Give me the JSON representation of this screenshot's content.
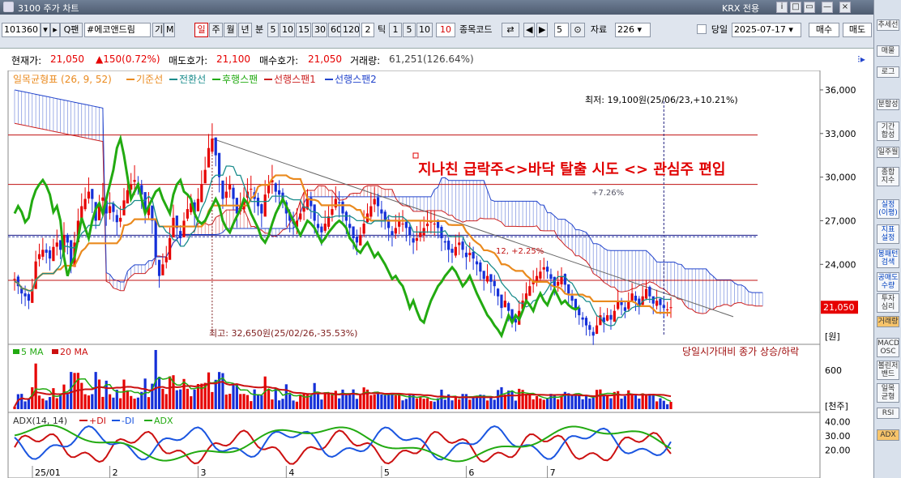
{
  "window": {
    "title": "3100 주가 차트",
    "market": "KRX 전용",
    "buttons": [
      "i",
      "□",
      "▭",
      "—",
      "×"
    ]
  },
  "toolbar": {
    "code": "101360",
    "name": "#에코앤드림",
    "name_btns": [
      "기",
      "M"
    ],
    "period_tabs": [
      "일",
      "주",
      "월",
      "년",
      "분"
    ],
    "active_period": "일",
    "minute_options": [
      "5",
      "10",
      "15",
      "30",
      "60",
      "120"
    ],
    "tick_label": "틱",
    "tick_value": "2",
    "tick_options": [
      "1",
      "5",
      "10"
    ],
    "tick_selected": "10",
    "compare_label": "종목코드",
    "step": "5",
    "data_label": "자료",
    "data_count": "226",
    "date_label": "당일",
    "date": "2025-07-17",
    "buy": "매수",
    "sell": "매도"
  },
  "info": {
    "current_label": "현재가:",
    "current": "21,050",
    "change": "▲150(0.72%)",
    "ask_label": "매도호가:",
    "ask": "21,100",
    "bid_label": "매수호가:",
    "bid": "21,050",
    "volume_label": "거래량:",
    "volume": "61,251(126.64%)"
  },
  "right_panel": [
    "추세선",
    "매물",
    "로그",
    "분할성",
    "기간\n합성",
    "일주월",
    "종합\n지수",
    "실정\n(이평)",
    "지표\n설정",
    "봉패턴\n검색",
    "공매도\n수량",
    "투자\n심리",
    "거래량",
    "MACD\nOSC",
    "볼린저\n밴드",
    "일목\n균형",
    "RSI",
    "ADX"
  ],
  "colors": {
    "up": "#e60000",
    "down": "#1530d8",
    "base": "#ea8a1e",
    "conv": "#1a8c8c",
    "lag": "#22aa11",
    "span1": "#cc2020",
    "span2": "#2244cc",
    "ma5": "#22aa11",
    "ma20": "#cc1010",
    "adx_pdi": "#cc1010",
    "adx_mdi": "#1a55e0",
    "adx": "#22aa11"
  },
  "chart_data": {
    "type": "candlestick",
    "indicator_legend": [
      {
        "name": "일목균형표 (26, 9, 52)",
        "color": "#ea8a1e"
      },
      {
        "name": "기준선",
        "color": "#ea8a1e"
      },
      {
        "name": "전환선",
        "color": "#1a8c8c"
      },
      {
        "name": "후행스팬",
        "color": "#22aa11"
      },
      {
        "name": "선행스팬1",
        "color": "#cc2020"
      },
      {
        "name": "선행스팬2",
        "color": "#2244cc"
      }
    ],
    "y_ticks": [
      "36,000",
      "33,000",
      "30,000",
      "27,000",
      "24,000"
    ],
    "y_tick_values": [
      36000,
      33000,
      30000,
      27000,
      24000
    ],
    "ylim": [
      18500,
      37000
    ],
    "unit_price": "[원]",
    "current_price": "21,050",
    "current_value": 21050,
    "annotation_title": "지나친 급락주<>바닥 탈출 시도 <> 관심주 편입",
    "annotation_low": "최저: 19,100원(25/06/23,+10.21%)",
    "annotation_high": "최고: 32,650원(25/02/26,-35.53%)",
    "annotation_mid": "12, +2.25%",
    "annotation_right": "+7.26%",
    "hlines": [
      32900,
      29500,
      26000,
      22900
    ],
    "months": [
      "25/01",
      "2",
      "3",
      "4",
      "5",
      "6",
      "7"
    ],
    "closes": [
      23000,
      22500,
      22000,
      21800,
      21500,
      22300,
      24200,
      24700,
      25000,
      24800,
      24400,
      25200,
      25500,
      25000,
      26000,
      25500,
      24000,
      25500,
      27000,
      28000,
      28500,
      29000,
      28500,
      27000,
      28200,
      28600,
      27500,
      28000,
      27600,
      26900,
      27200,
      28400,
      29100,
      29500,
      29800,
      29400,
      28800,
      27600,
      28000,
      27000,
      24500,
      23200,
      24000,
      24500,
      25800,
      27200,
      26500,
      25800,
      27000,
      27800,
      28200,
      27500,
      28500,
      29500,
      30500,
      32000,
      32650,
      31500,
      30000,
      28500,
      29000,
      29500,
      28500,
      27500,
      28000,
      28500,
      29000,
      29200,
      28500,
      28000,
      27500,
      28800,
      29500,
      29800,
      29000,
      28800,
      28500,
      27500,
      27000,
      26800,
      27000,
      27500,
      28000,
      28500,
      28000,
      27000,
      26500,
      26200,
      26800,
      27300,
      27800,
      28500,
      28200,
      27500,
      27000,
      26500,
      25800,
      25500,
      26000,
      26800,
      27500,
      28000,
      28500,
      28000,
      27500,
      27000,
      26500,
      26000,
      26500,
      27000,
      26800,
      26500,
      26000,
      25500,
      25800,
      26200,
      26500,
      26800,
      27000,
      26800,
      26500,
      25800,
      25500,
      25000,
      24800,
      25200,
      25500,
      25000,
      24500,
      24800,
      24400,
      24000,
      23500,
      23000,
      23200,
      22800,
      22500,
      21800,
      21000,
      21500,
      20800,
      20200,
      20000,
      20800,
      21500,
      22000,
      22500,
      22800,
      23200,
      23500,
      23800,
      23500,
      23000,
      22500,
      22800,
      23200,
      22600,
      22000,
      21500,
      21000,
      20500,
      20200,
      19800,
      19500,
      19100,
      19800,
      20500,
      20000,
      20500,
      20200,
      20800,
      21500,
      21200,
      20800,
      21500,
      22000,
      21500,
      21200,
      21800,
      22300,
      21800,
      21300,
      21500,
      21200,
      21000,
      20900,
      21050
    ],
    "volume_unit": "[천주]",
    "volume_ticks": [
      "600"
    ],
    "volume_ticks_values": [
      600
    ],
    "volume_legend": [
      {
        "name": "5 MA",
        "color": "#22aa11"
      },
      {
        "name": "20 MA",
        "color": "#cc1010"
      }
    ],
    "volume_note": "당일시가대비 종가 상승/하락",
    "adx_legend": "ADX(14, 14)",
    "adx_series": [
      {
        "name": "+DI",
        "color": "#cc1010"
      },
      {
        "name": "-DI",
        "color": "#1a55e0"
      },
      {
        "name": "ADX",
        "color": "#22aa11"
      }
    ],
    "adx_ticks": [
      "40.00",
      "30.00",
      "20.00"
    ],
    "adx_tick_values": [
      40,
      30,
      20
    ]
  }
}
